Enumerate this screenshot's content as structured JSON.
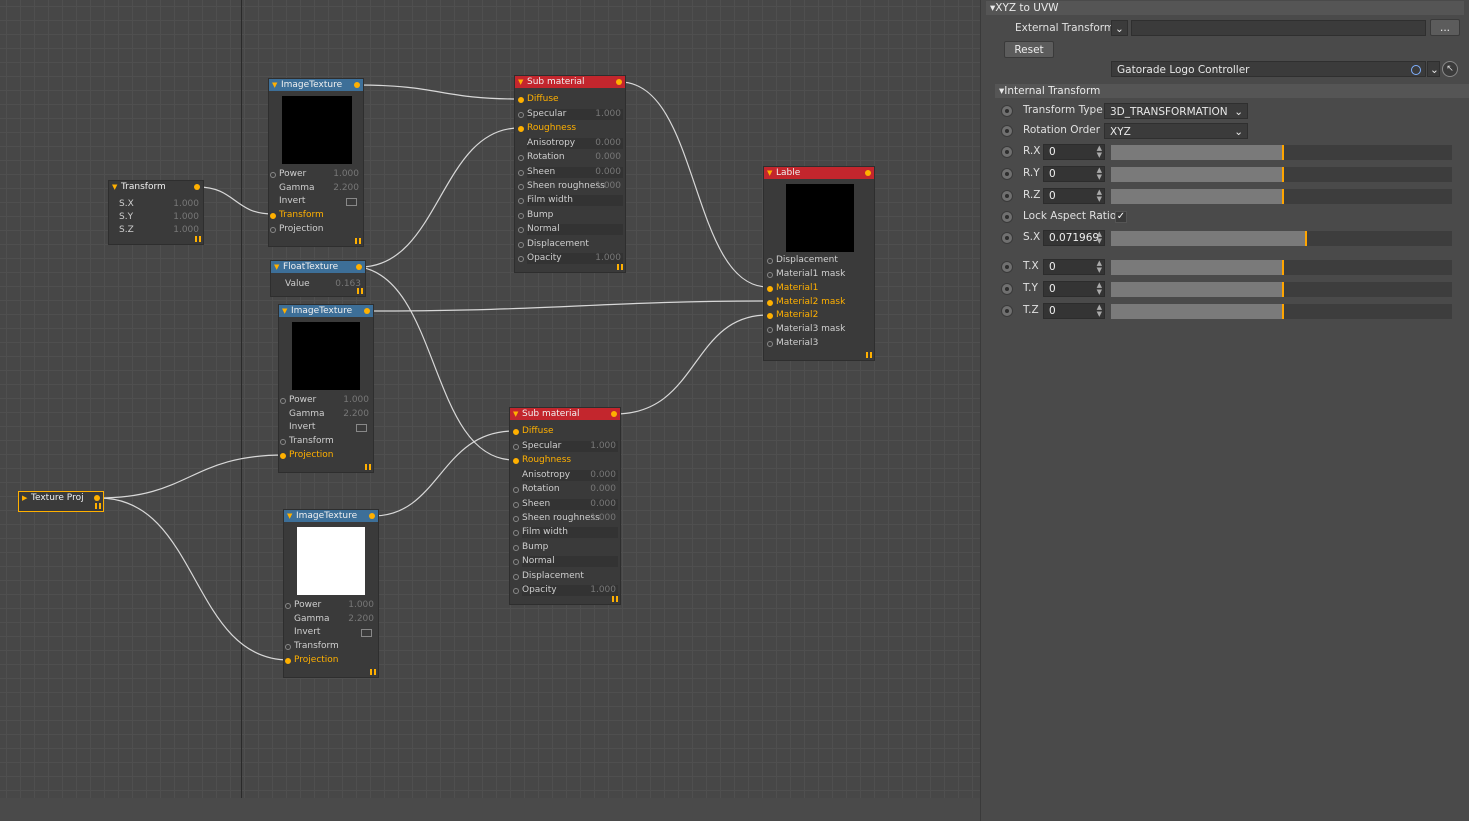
{
  "nodes": {
    "transform": {
      "title": "Transform",
      "rows": [
        {
          "label": "S.X",
          "value": "1.000"
        },
        {
          "label": "S.Y",
          "value": "1.000"
        },
        {
          "label": "S.Z",
          "value": "1.000"
        }
      ]
    },
    "imagetex1": {
      "title": "ImageTexture",
      "rows": [
        {
          "label": "Power",
          "value": "1.000"
        },
        {
          "label": "Gamma",
          "value": "2.200"
        },
        {
          "label": "Invert",
          "value": ""
        },
        {
          "label": "Transform",
          "value": ""
        },
        {
          "label": "Projection",
          "value": ""
        }
      ]
    },
    "floattex": {
      "title": "FloatTexture",
      "rows": [
        {
          "label": "Value",
          "value": "0.163"
        }
      ]
    },
    "imagetex2": {
      "title": "ImageTexture",
      "rows": [
        {
          "label": "Power",
          "value": "1.000"
        },
        {
          "label": "Gamma",
          "value": "2.200"
        },
        {
          "label": "Invert",
          "value": ""
        },
        {
          "label": "Transform",
          "value": ""
        },
        {
          "label": "Projection",
          "value": ""
        }
      ]
    },
    "imagetex3": {
      "title": "ImageTexture",
      "rows": [
        {
          "label": "Power",
          "value": "1.000"
        },
        {
          "label": "Gamma",
          "value": "2.200"
        },
        {
          "label": "Invert",
          "value": ""
        },
        {
          "label": "Transform",
          "value": ""
        },
        {
          "label": "Projection",
          "value": ""
        }
      ]
    },
    "textureproj": {
      "title": "Texture Proj"
    },
    "submat1": {
      "title": "Sub material",
      "rows": [
        {
          "label": "Diffuse",
          "value": ""
        },
        {
          "label": "Specular",
          "value": "1.000"
        },
        {
          "label": "Roughness",
          "value": ""
        },
        {
          "label": "Anisotropy",
          "value": "0.000"
        },
        {
          "label": "Rotation",
          "value": "0.000"
        },
        {
          "label": "Sheen",
          "value": "0.000"
        },
        {
          "label": "Sheen roughness",
          "value": "1.000"
        },
        {
          "label": "Film width",
          "value": ""
        },
        {
          "label": "Bump",
          "value": ""
        },
        {
          "label": "Normal",
          "value": ""
        },
        {
          "label": "Displacement",
          "value": ""
        },
        {
          "label": "Opacity",
          "value": "1.000"
        }
      ]
    },
    "submat2": {
      "title": "Sub material",
      "rows": [
        {
          "label": "Diffuse",
          "value": ""
        },
        {
          "label": "Specular",
          "value": "1.000"
        },
        {
          "label": "Roughness",
          "value": ""
        },
        {
          "label": "Anisotropy",
          "value": "0.000"
        },
        {
          "label": "Rotation",
          "value": "0.000"
        },
        {
          "label": "Sheen",
          "value": "0.000"
        },
        {
          "label": "Sheen roughness",
          "value": "1.000"
        },
        {
          "label": "Film width",
          "value": ""
        },
        {
          "label": "Bump",
          "value": ""
        },
        {
          "label": "Normal",
          "value": ""
        },
        {
          "label": "Displacement",
          "value": ""
        },
        {
          "label": "Opacity",
          "value": "1.000"
        }
      ]
    },
    "lable": {
      "title": "Lable",
      "rows": [
        {
          "label": "Displacement"
        },
        {
          "label": "Material1 mask"
        },
        {
          "label": "Material1"
        },
        {
          "label": "Material2 mask"
        },
        {
          "label": "Material2"
        },
        {
          "label": "Material3 mask"
        },
        {
          "label": "Material3"
        }
      ]
    }
  },
  "panel": {
    "section_title": "XYZ to UVW",
    "external_transform_label": "External Transform",
    "external_more": "...",
    "reset_label": "Reset",
    "controller_value": "Gatorade Logo Controller",
    "internal_title": "Internal Transform",
    "transform_type_label": "Transform Type",
    "transform_type_value": "3D_TRANSFORMATION",
    "rotation_order_label": "Rotation Order",
    "rotation_order_value": "XYZ",
    "params": [
      {
        "label": "R.X",
        "value": "0",
        "level": 0.5
      },
      {
        "label": "R.Y",
        "value": "0",
        "level": 0.5
      },
      {
        "label": "R.Z",
        "value": "0",
        "level": 0.5
      },
      {
        "label": "S.X",
        "value": "0.071969",
        "level": 0.57
      },
      {
        "label": "T.X",
        "value": "0",
        "level": 0.5
      },
      {
        "label": "T.Y",
        "value": "0",
        "level": 0.5
      },
      {
        "label": "T.Z",
        "value": "0",
        "level": 0.5
      }
    ],
    "lock_aspect_label": "Lock Aspect Ratio",
    "lock_aspect_checked": true
  },
  "colors": {
    "accent": "#ffb000",
    "node_blue": "#3d6f98",
    "node_red": "#c3262d",
    "slider_mark": "#ffa500"
  }
}
